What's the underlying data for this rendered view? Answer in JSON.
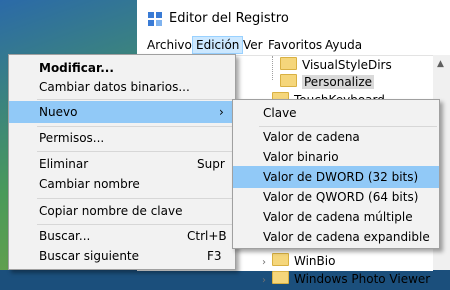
{
  "window": {
    "title": "Editor del Registro",
    "icon": "registry-icon"
  },
  "menubar": [
    "Archivo",
    "Edición",
    "Ver",
    "Favoritos",
    "Ayuda"
  ],
  "tree": {
    "nodes": [
      "VisualStyleDirs",
      "Personalize",
      "TouchKeyboard",
      "WinBio",
      "Windows Photo Viewer"
    ]
  },
  "edit_menu": {
    "items": [
      {
        "label": "Modificar...",
        "shortcut": ""
      },
      {
        "label": "Cambiar datos binarios...",
        "shortcut": ""
      },
      {
        "label": "Nuevo",
        "shortcut": "›"
      },
      {
        "label": "Permisos...",
        "shortcut": ""
      },
      {
        "label": "Eliminar",
        "shortcut": "Supr"
      },
      {
        "label": "Cambiar nombre",
        "shortcut": ""
      },
      {
        "label": "Copiar nombre de clave",
        "shortcut": ""
      },
      {
        "label": "Buscar...",
        "shortcut": "Ctrl+B"
      },
      {
        "label": "Buscar siguiente",
        "shortcut": "F3"
      }
    ]
  },
  "new_submenu": {
    "items": [
      "Clave",
      "Valor de cadena",
      "Valor binario",
      "Valor de DWORD (32 bits)",
      "Valor de QWORD (64 bits)",
      "Valor de cadena múltiple",
      "Valor de cadena expandible"
    ]
  }
}
